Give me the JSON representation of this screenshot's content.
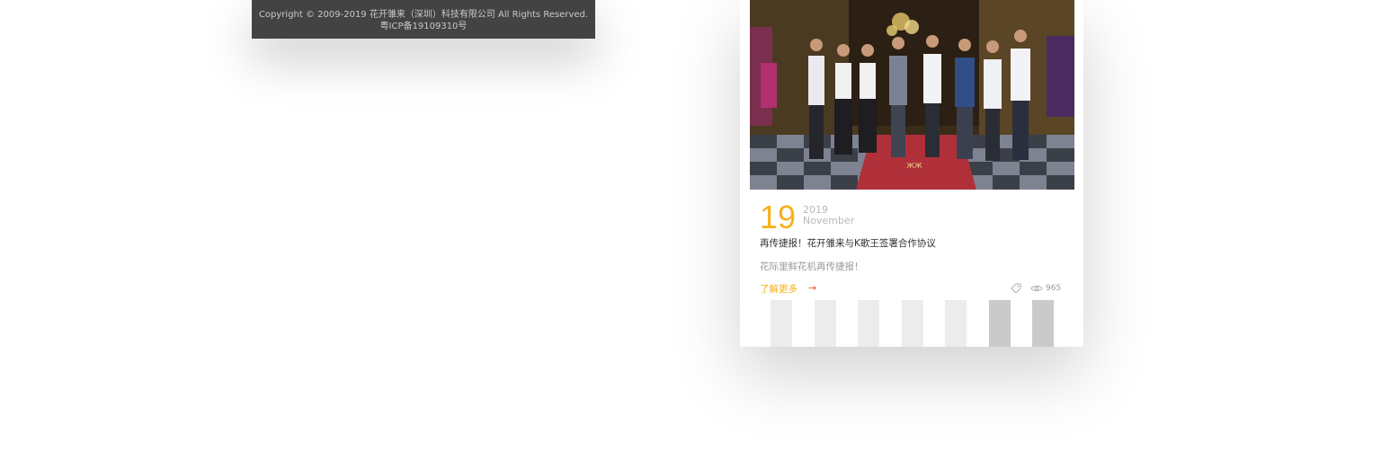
{
  "footer": {
    "copyright": "Copyright © 2009-2019 花开雏来（深圳）科技有限公司 All Rights Reserved.",
    "icp": "粤ICP备19109310号"
  },
  "news_card": {
    "day": "19",
    "year": "2019",
    "month": "November",
    "title": "再传捷报！花开雏来与K歌王签署合作协议",
    "description": "花际里鲜花机再传捷报！",
    "more_label": "了解更多",
    "more_arrow": "→",
    "tag_icon": "tag-icon",
    "eye_icon": "eye-icon",
    "views": "965"
  },
  "pager_bars": [
    {
      "state": "light"
    },
    {
      "state": "light"
    },
    {
      "state": "light"
    },
    {
      "state": "light"
    },
    {
      "state": "light"
    },
    {
      "state": "dark"
    },
    {
      "state": "dark"
    }
  ],
  "colors": {
    "accent": "#f5b21b",
    "arrow": "#e2572b",
    "footer_bg": "#434343"
  }
}
